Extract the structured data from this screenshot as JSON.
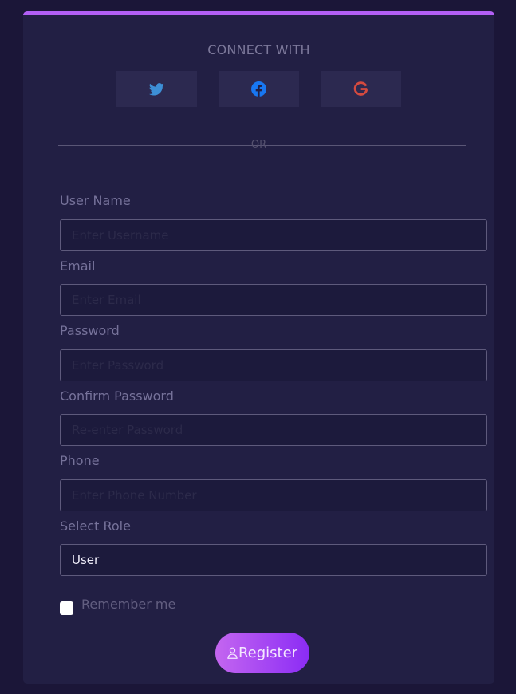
{
  "header": {
    "connect_title": "CONNECT WITH",
    "or_text": "OR"
  },
  "social": {
    "twitter_icon": "twitter-icon",
    "facebook_icon": "facebook-icon",
    "google_icon": "google-icon"
  },
  "form": {
    "username": {
      "label": "User Name",
      "placeholder": "Enter Username",
      "value": ""
    },
    "email": {
      "label": "Email",
      "placeholder": "Enter Email",
      "value": ""
    },
    "password": {
      "label": "Password",
      "placeholder": "Enter Password",
      "value": ""
    },
    "confirm_password": {
      "label": "Confirm Password",
      "placeholder": "Re-enter Password",
      "value": ""
    },
    "phone": {
      "label": "Phone",
      "placeholder": "Enter Phone Number",
      "value": ""
    },
    "role": {
      "label": "Select Role",
      "value": "User"
    },
    "remember_label": "Remember me",
    "register_label": "Register"
  },
  "colors": {
    "background": "#1b1638",
    "card": "#221f44",
    "accent": "#b25ff5",
    "twitter": "#3d8fd6",
    "facebook": "#1877f2",
    "google": "#d44a3f"
  }
}
